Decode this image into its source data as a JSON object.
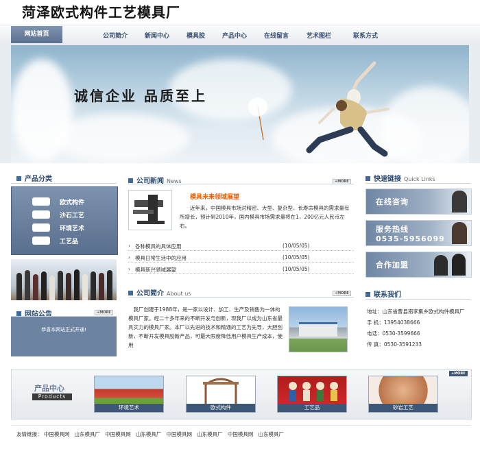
{
  "header": {
    "title": "菏泽欧式构件工艺模具厂"
  },
  "nav": {
    "home": "网站首页",
    "items": [
      "公司简介",
      "新闻中心",
      "模具胶",
      "产品中心",
      "在线留言",
      "艺术图栏",
      "联系方式"
    ]
  },
  "banner": {
    "slogan": "诚信企业  品质至上"
  },
  "categories": {
    "title": "产品分类",
    "items": [
      "欧式构件",
      "沙石工艺",
      "环境艺术",
      "工艺品"
    ]
  },
  "notice": {
    "title": "网站公告",
    "more": "+MORE",
    "text": "恭喜本网站正式开通!"
  },
  "news": {
    "title": "公司新闻",
    "subtitle": "News",
    "more": "+MORE",
    "headline": "模具未来领域展望",
    "summary": "近年来，中国模具市场对精密、大型、复杂型、长寿命模具的需求量有所增长，预计到2010年，国内模具市场需求量将在1，200亿元人民币左右。",
    "items": [
      {
        "title": "各种模具的具体应用",
        "date": "(10/05/05)"
      },
      {
        "title": "模具日常生活中的应用",
        "date": "(10/05/05)"
      },
      {
        "title": "模具新兴领域展望",
        "date": "(10/05/05)"
      }
    ]
  },
  "about": {
    "title": "公司简介",
    "subtitle": "About us",
    "more": "+MORE",
    "text": "我厂创建于1988年，是一家以设计、加工、生产及销售为一体的模具厂家。经二十多年来的不断开发与创新，现我厂以成为山东省最具实力的模具厂家。本厂以先进的技术和精通的工艺为先导，大胆创新，不断开发模具胶新产品，可最大限度降低用户模具生产成本，使用"
  },
  "quick_links": {
    "title": "快速链接",
    "subtitle": "Quick Links",
    "items": [
      {
        "label": "在线咨询"
      },
      {
        "label": "服务热线",
        "phone": "0535-5956099"
      },
      {
        "label": "合作加盟"
      }
    ]
  },
  "contact": {
    "title": "联系我们",
    "lines": [
      "地址：山东省曹县南李集乡欧式构件模具厂",
      "手  机：13954038666",
      "电话：0530-3599666",
      "传  真：0530-3591233"
    ]
  },
  "products": {
    "title": "产品中心",
    "subtitle": "Products",
    "more": "+MORE",
    "items": [
      "环境艺术",
      "欧式构件",
      "工艺品",
      "砂岩工艺"
    ]
  },
  "footer": {
    "label": "友情链接：",
    "links": [
      "中国模具网",
      "山东模具厂",
      "中国模具网",
      "山东模具厂",
      "中国模具网",
      "山东模具厂",
      "中国模具网",
      "山东模具厂"
    ]
  }
}
